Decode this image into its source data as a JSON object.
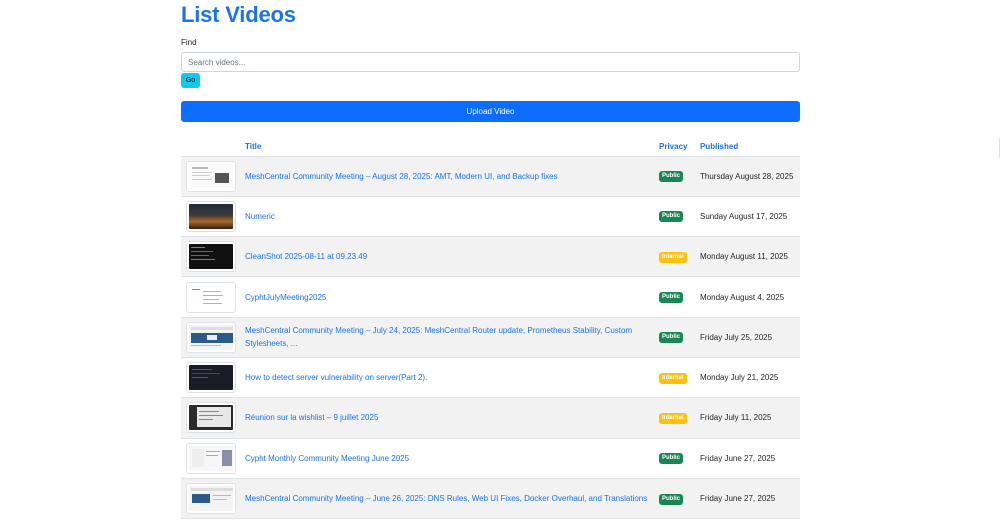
{
  "page": {
    "title": "List Videos",
    "find_label": "Find",
    "search_placeholder": "Search videos...",
    "go_label": "Go",
    "upload_label": "Upload Video"
  },
  "table": {
    "headers": {
      "title": "Title",
      "privacy": "Privacy",
      "published": "Published"
    },
    "rows": [
      {
        "title": "MeshCentral Community Meeting – August 28, 2025: AMT, Modern UI, and Backup fixes",
        "privacy": "Public",
        "published": "Thursday August 28, 2025",
        "thumb": "light-doc"
      },
      {
        "title": "Numeric",
        "privacy": "Public",
        "published": "Sunday August 17, 2025",
        "thumb": "sunset"
      },
      {
        "title": "CleanShot 2025-08-11 at 09.23.49",
        "privacy": "Internal",
        "published": "Monday August 11, 2025",
        "thumb": "dark-terminal"
      },
      {
        "title": "CyphtJulyMeeting2025",
        "privacy": "Public",
        "published": "Monday August 4, 2025",
        "thumb": "light-list"
      },
      {
        "title": "MeshCentral Community Meeting – July 24, 2025: MeshCentral Router update, Prometheus Stability, Custom Stylesheets, ...",
        "privacy": "Public",
        "published": "Friday July 25, 2025",
        "thumb": "blue-window"
      },
      {
        "title": "How to detect server vulnerability on server(Part 2).",
        "privacy": "Internal",
        "published": "Monday July 21, 2025",
        "thumb": "dark-terminal-2"
      },
      {
        "title": "Réunion sur la wishlist – 9 juillet 2025",
        "privacy": "Internal",
        "published": "Friday July 11, 2025",
        "thumb": "dark-window"
      },
      {
        "title": "Cypht Monthly Community Meeting June 2025",
        "privacy": "Public",
        "published": "Friday June 27, 2025",
        "thumb": "light-person"
      },
      {
        "title": "MeshCentral Community Meeting – June 26, 2025: DNS Rules, Web UI Fixes, Docker Overhaul, and Translations",
        "privacy": "Public",
        "published": "Friday June 27, 2025",
        "thumb": "blue-window-2"
      }
    ]
  },
  "colors": {
    "accent": "#1a73e8",
    "primary_button": "#0d6efd",
    "go_button": "#0dcaf0",
    "badge_public": "#198754",
    "badge_internal": "#ffc107",
    "row_stripe": "#f2f2f2"
  }
}
